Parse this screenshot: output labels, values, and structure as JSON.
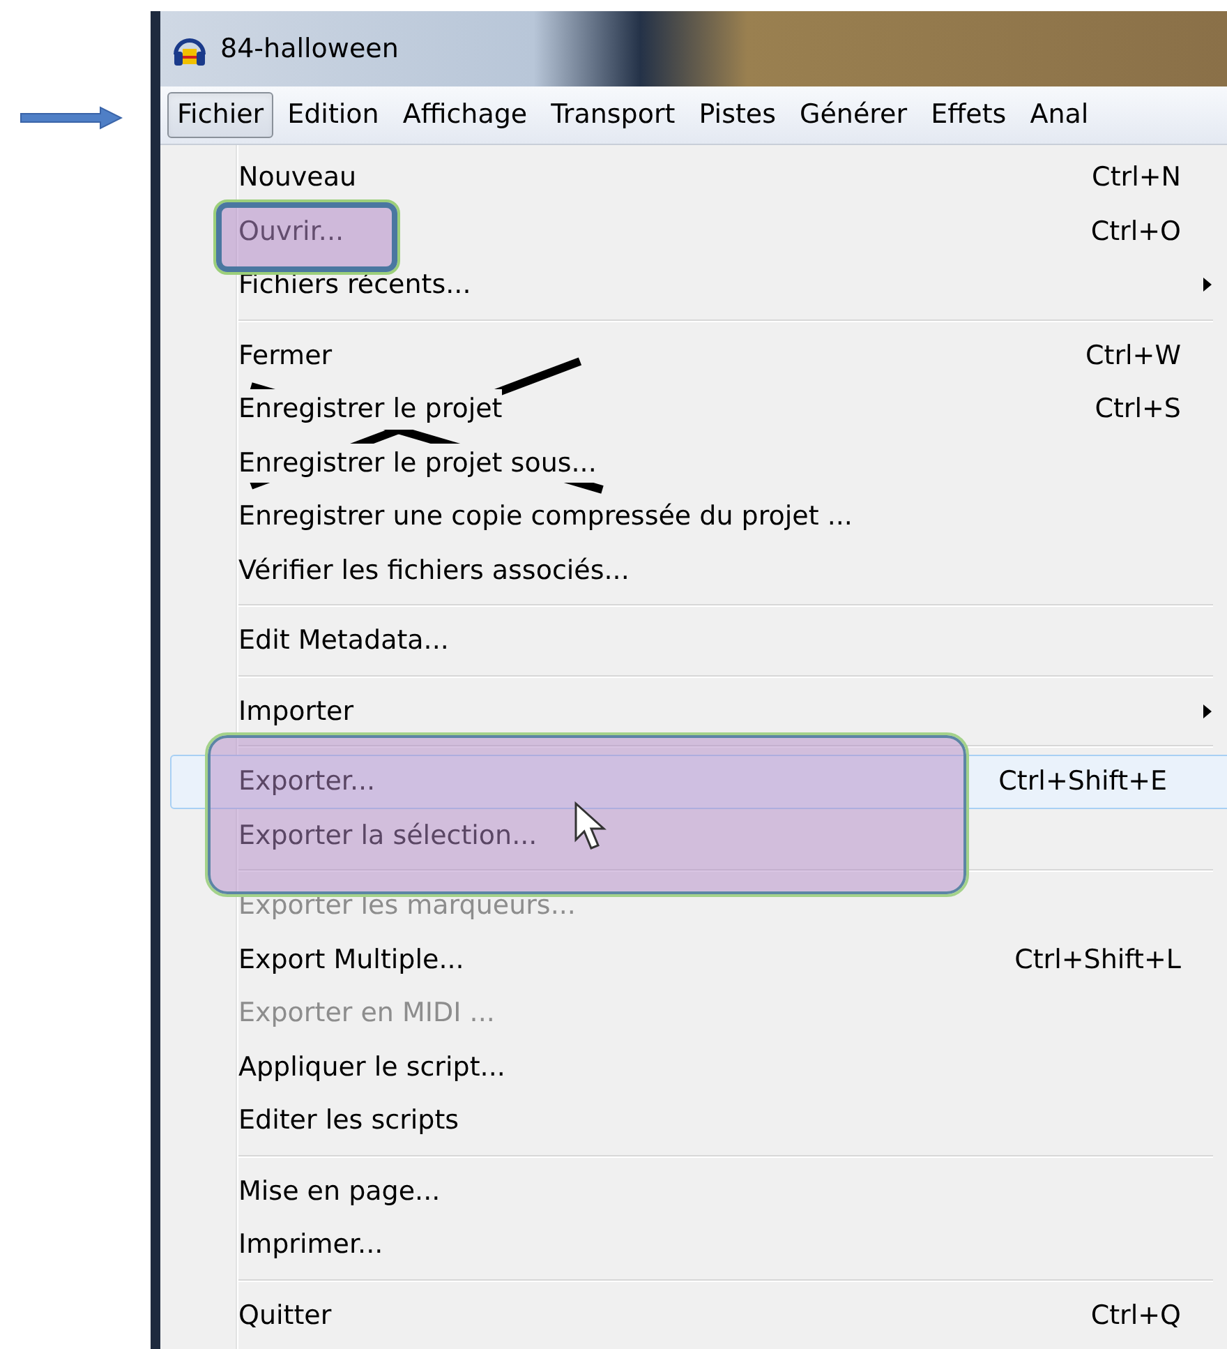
{
  "window": {
    "title": "84-halloween"
  },
  "menu_bar": [
    {
      "label": "Fichier",
      "selected": true
    },
    {
      "label": "Edition",
      "selected": false
    },
    {
      "label": "Affichage",
      "selected": false
    },
    {
      "label": "Transport",
      "selected": false
    },
    {
      "label": "Pistes",
      "selected": false
    },
    {
      "label": "Générer",
      "selected": false
    },
    {
      "label": "Effets",
      "selected": false
    },
    {
      "label": "Anal",
      "selected": false
    }
  ],
  "menu": [
    {
      "kind": "item",
      "label": "Nouveau",
      "shortcut": "Ctrl+N",
      "disabled": false,
      "selected": false
    },
    {
      "kind": "item",
      "label": "Ouvrir...",
      "shortcut": "Ctrl+O",
      "disabled": false,
      "selected": false
    },
    {
      "kind": "submenu",
      "label": "Fichiers récents...",
      "disabled": false,
      "selected": false
    },
    {
      "kind": "separator"
    },
    {
      "kind": "item",
      "label": "Fermer",
      "shortcut": "Ctrl+W",
      "disabled": false,
      "selected": false
    },
    {
      "kind": "item",
      "label": "Enregistrer le projet",
      "shortcut": "Ctrl+S",
      "disabled": false,
      "selected": false
    },
    {
      "kind": "item",
      "label": "Enregistrer le projet sous...",
      "disabled": false,
      "selected": false
    },
    {
      "kind": "item",
      "label": "Enregistrer une copie compressée du projet ...",
      "disabled": false,
      "selected": false
    },
    {
      "kind": "item",
      "label": "Vérifier les fichiers associés...",
      "disabled": false,
      "selected": false
    },
    {
      "kind": "separator"
    },
    {
      "kind": "item",
      "label": "Edit Metadata...",
      "disabled": false,
      "selected": false
    },
    {
      "kind": "separator"
    },
    {
      "kind": "submenu",
      "label": "Importer",
      "disabled": false,
      "selected": false
    },
    {
      "kind": "separator"
    },
    {
      "kind": "item",
      "label": "Exporter...",
      "shortcut": "Ctrl+Shift+E",
      "disabled": false,
      "selected": true
    },
    {
      "kind": "item",
      "label": "Exporter la sélection...",
      "disabled": false,
      "selected": false
    },
    {
      "kind": "separator"
    },
    {
      "kind": "item",
      "label": "Exporter les marqueurs...",
      "disabled": true,
      "selected": false
    },
    {
      "kind": "item",
      "label": "Export Multiple...",
      "shortcut": "Ctrl+Shift+L",
      "disabled": false,
      "selected": false
    },
    {
      "kind": "item",
      "label": "Exporter en MIDI ...",
      "disabled": true,
      "selected": false
    },
    {
      "kind": "item",
      "label": "Appliquer le script...",
      "disabled": false,
      "selected": false
    },
    {
      "kind": "item",
      "label": "Editer les scripts",
      "disabled": false,
      "selected": false
    },
    {
      "kind": "separator"
    },
    {
      "kind": "item",
      "label": "Mise en page...",
      "disabled": false,
      "selected": false
    },
    {
      "kind": "item",
      "label": "Imprimer...",
      "disabled": false,
      "selected": false
    },
    {
      "kind": "separator"
    },
    {
      "kind": "item",
      "label": "Quitter",
      "shortcut": "Ctrl+Q",
      "disabled": false,
      "selected": false
    }
  ]
}
